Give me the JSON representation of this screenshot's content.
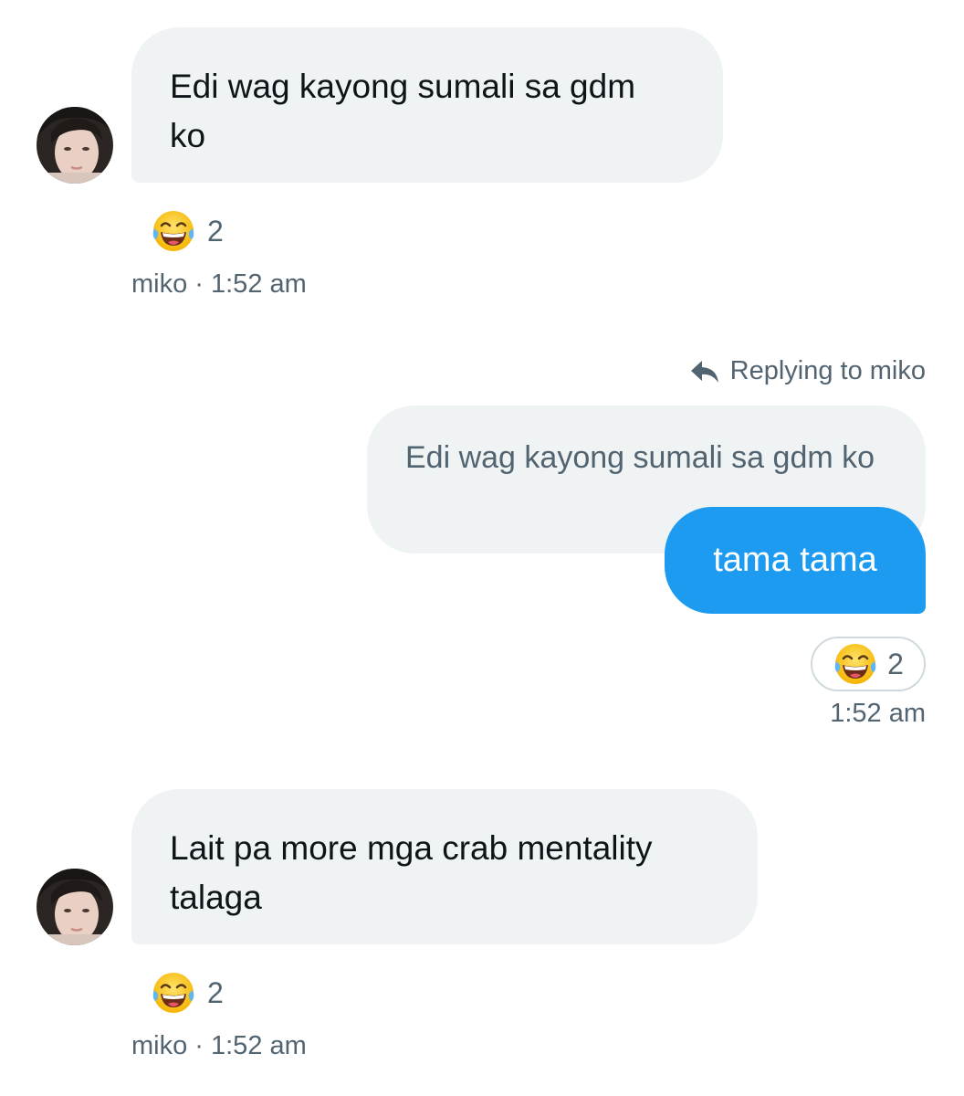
{
  "messages": [
    {
      "sender": "miko",
      "text_line1": "Edi wag kayong sumali sa gdm",
      "text_line2": "ko",
      "reaction_count": "2",
      "meta": "miko · 1:52 am"
    },
    {
      "sender": "me",
      "reply_context": "Replying to miko",
      "quoted_text": "Edi wag kayong sumali sa gdm ko",
      "text": "tama tama",
      "reaction_count": "2",
      "meta": "1:52 am"
    },
    {
      "sender": "miko",
      "text_line1": "Lait pa more mga crab mentality",
      "text_line2": "talaga",
      "reaction_count": "2",
      "meta": "miko · 1:52 am"
    }
  ],
  "icons": {
    "reaction": "face-with-tears-of-joy-icon",
    "reply": "reply-arrow-icon",
    "avatar": "avatar"
  },
  "colors": {
    "incoming_bubble": "#eff3f4",
    "outgoing_bubble": "#1d9bf0",
    "secondary_text": "#536471",
    "primary_text": "#0f1419"
  }
}
